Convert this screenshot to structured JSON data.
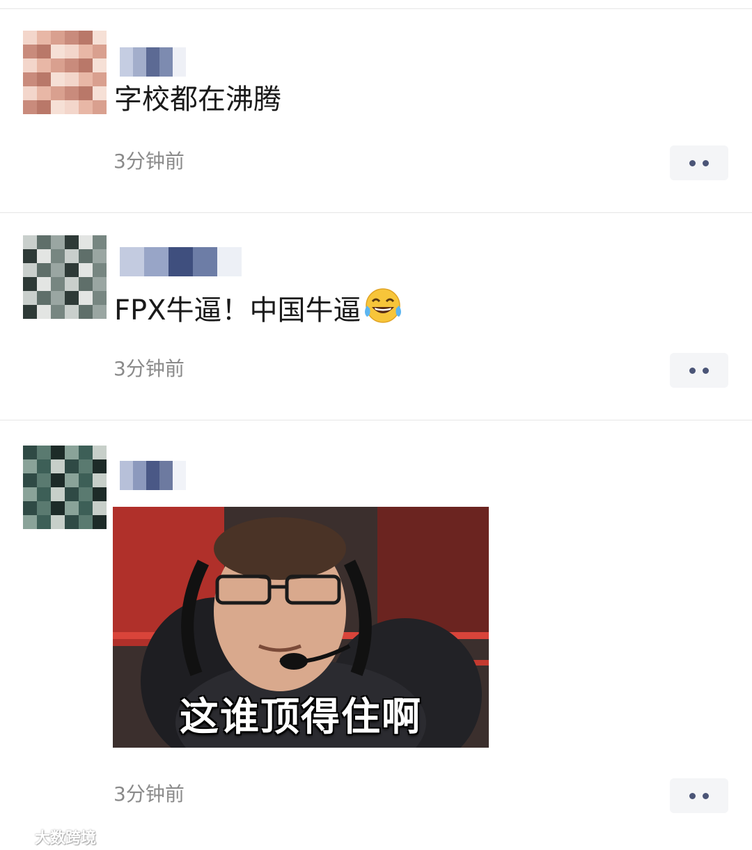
{
  "posts": [
    {
      "text": "字校都在沸腾",
      "time": "3分钟前",
      "avatar_palette": [
        "#f3d6cb",
        "#e8b7a6",
        "#d9a08f",
        "#c98b7c",
        "#b97869",
        "#f6e0d6"
      ],
      "name_palette": [
        "#7d8bb0",
        "#c5cde2",
        "#5c6a94",
        "#eef0f6",
        "#a3aecb"
      ]
    },
    {
      "text": "FPX牛逼！中国牛逼",
      "emoji": "tears-of-joy-emoji",
      "time": "3分钟前",
      "avatar_palette": [
        "#c9cfcc",
        "#5f6f6a",
        "#9aa6a2",
        "#2e3a37",
        "#e3e5e3",
        "#778681"
      ],
      "name_palette": [
        "#6d7da6",
        "#c3cbe0",
        "#3f4f7e",
        "#edf0f6",
        "#98a5c7"
      ]
    },
    {
      "image_caption": "这谁顶得住啊",
      "time": "3分钟前",
      "avatar_palette": [
        "#2f4a45",
        "#5a7a70",
        "#1d2b28",
        "#8aa399",
        "#3d5f57",
        "#c7cfc9"
      ],
      "name_palette": [
        "#6d7aa0",
        "#b7c0d9",
        "#4a5886",
        "#f1f3f8",
        "#8c99bd"
      ]
    }
  ],
  "watermark": "大数跨境"
}
